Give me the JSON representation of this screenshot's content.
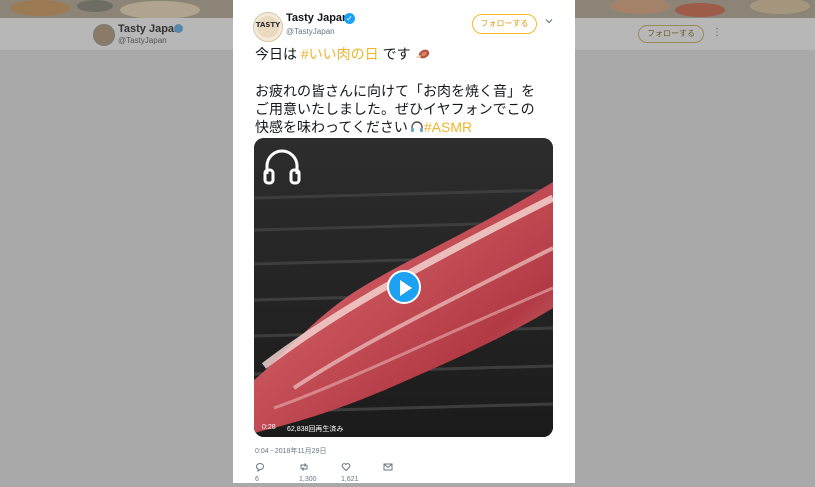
{
  "background_profile": {
    "name": "Tasty Japan",
    "handle": "@TastyJapan",
    "follow_label": "フォローする"
  },
  "tweet": {
    "author_name": "Tasty Japan",
    "author_handle": "@TastyJapan",
    "follow_label": "フォローする",
    "line1_prefix": "今日は ",
    "line1_hashtag": "#いい肉の日",
    "line1_suffix": " です",
    "line2": "お疲れの皆さんに向けて「お肉を焼く音」を",
    "line3": "ご用意いたしました。ぜひイヤフォンでこの",
    "line4_prefix": "快感を味わってください",
    "line4_hashtag": "#ASMR",
    "video": {
      "duration": "0:28",
      "views": "62,838回再生済み"
    },
    "timestamp": "0:04 - 2018年11月29日",
    "replies": "6",
    "retweets": "1,300",
    "likes": "1,621"
  },
  "colors": {
    "accent": "#f0b429",
    "verified": "#1da1f2",
    "overlay": "#a9a9a9"
  },
  "icons": [
    "verified-badge-icon",
    "chevron-down-icon",
    "meat-emoji-icon",
    "headphones-emoji-icon",
    "headphones-icon",
    "play-icon",
    "reply-icon",
    "retweet-icon",
    "like-icon",
    "message-icon"
  ]
}
